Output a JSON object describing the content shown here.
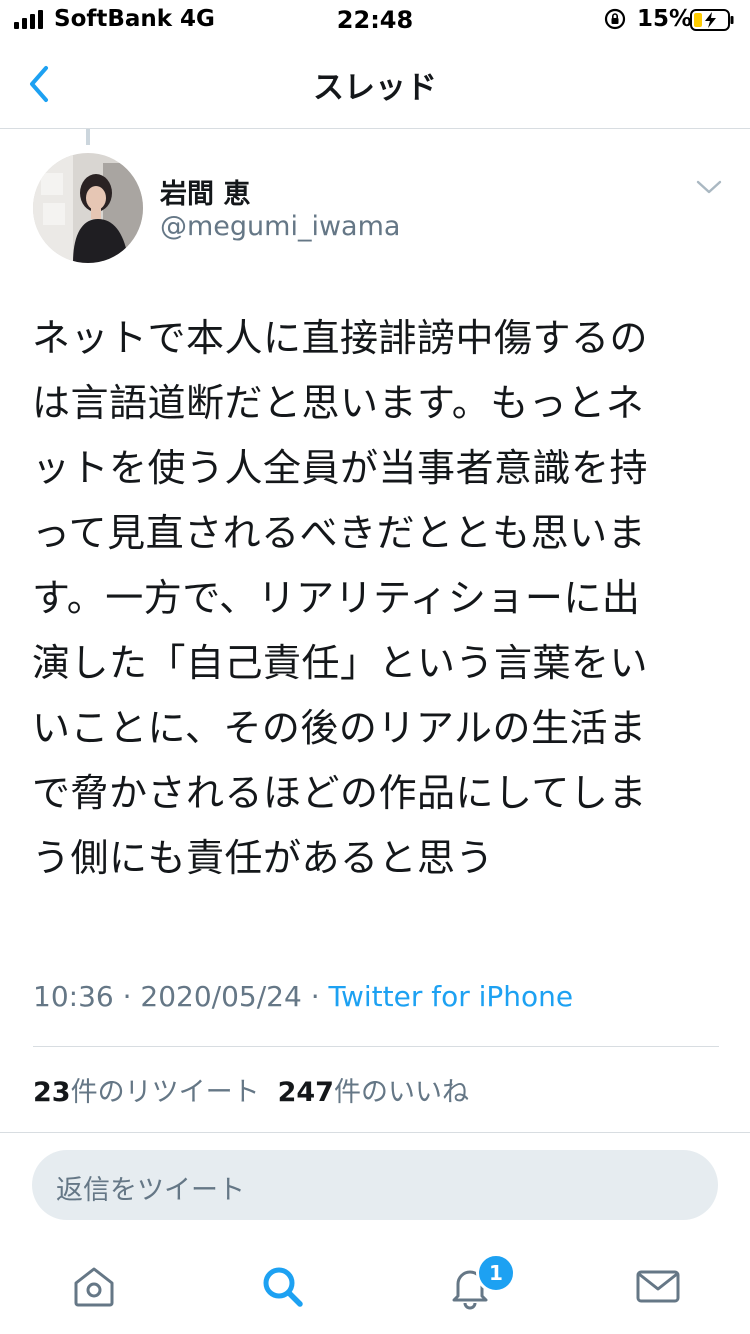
{
  "status_bar": {
    "carrier": "SoftBank",
    "network": "4G",
    "time": "22:48",
    "battery_percent": "15%"
  },
  "nav": {
    "title": "スレッド"
  },
  "tweet": {
    "display_name": "岩間 恵",
    "username": "@megumi_iwama",
    "text": "ネットで本人に直接誹謗中傷するの\nは言語道断だと思います。もっとネ\nットを使う人全員が当事者意識を持\nって見直されるべきだととも思いま\nす。一方で、リアリティショーに出\n演した「自己責任」という言葉をい\nいことに、その後のリアルの生活ま\nで脅かされるほどの作品にしてしま\nう側にも責任があると思う",
    "time": "10:36",
    "date": "2020/05/24",
    "separator": " · ",
    "source": "Twitter for iPhone",
    "retweet_count": "23",
    "retweet_label": "件のリツイート",
    "like_count": "247",
    "like_label": "件のいいね"
  },
  "reply": {
    "placeholder": "返信をツイート"
  },
  "tab_bar": {
    "notifications_badge": "1",
    "accent_color": "#1da1f2",
    "icon_color": "#657786"
  }
}
